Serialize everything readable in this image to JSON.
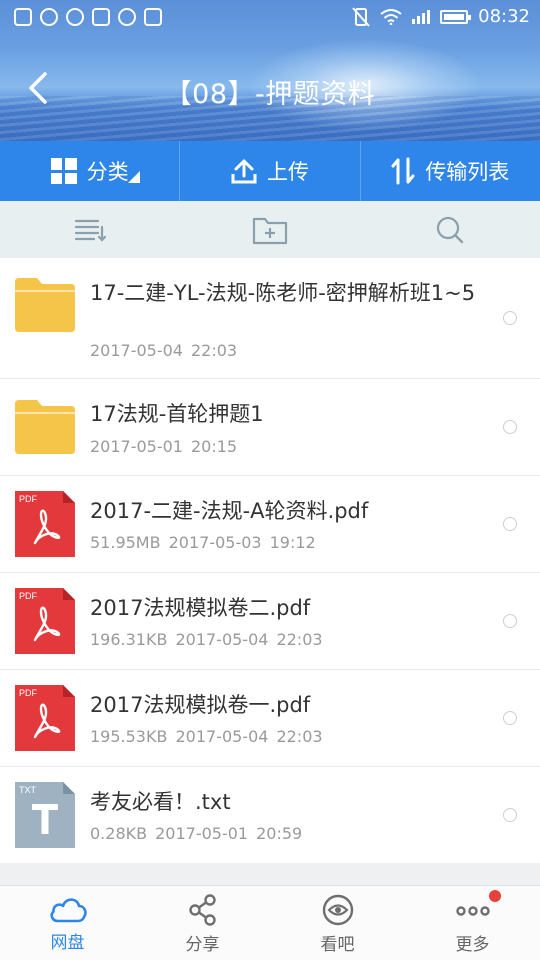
{
  "status_bar": {
    "time": "08:32",
    "left_icons": [
      "s-app-icon",
      "sync-app-icon",
      "chat-app-icon",
      "gallery-icon",
      "circle-app-icon",
      "grid-app-icon"
    ],
    "right_icons": [
      "vibrate-off-icon",
      "wifi-icon",
      "signal-icon",
      "battery-icon"
    ]
  },
  "header": {
    "title": "【08】-押题资料",
    "back_icon": "chevron-left-icon"
  },
  "action_bar": {
    "category_label": "分类",
    "upload_label": "上传",
    "transfer_label": "传输列表"
  },
  "toolbar": {
    "icons": [
      "sort-list-icon",
      "new-folder-icon",
      "search-icon"
    ]
  },
  "files": [
    {
      "name": "17-二建-YL-法规-陈老师-密押解析班1~5",
      "size": "",
      "date": "2017-05-04",
      "time": "22:03",
      "type": "folder"
    },
    {
      "name": "17法规-首轮押题1",
      "size": "",
      "date": "2017-05-01",
      "time": "20:15",
      "type": "folder"
    },
    {
      "name": "2017-二建-法规-A轮资料.pdf",
      "size": "51.95MB",
      "date": "2017-05-03",
      "time": "19:12",
      "type": "pdf"
    },
    {
      "name": "2017法规模拟卷二.pdf",
      "size": "196.31KB",
      "date": "2017-05-04",
      "time": "22:03",
      "type": "pdf"
    },
    {
      "name": "2017法规模拟卷一.pdf",
      "size": "195.53KB",
      "date": "2017-05-04",
      "time": "22:03",
      "type": "pdf"
    },
    {
      "name": "考友必看！.txt",
      "size": "0.28KB",
      "date": "2017-05-01",
      "time": "20:59",
      "type": "txt"
    }
  ],
  "file_badges": {
    "pdf": "PDF",
    "txt": "TXT"
  },
  "bottom_nav": [
    {
      "label": "网盘",
      "icon": "cloud-icon",
      "active": true
    },
    {
      "label": "分享",
      "icon": "share-icon",
      "active": false
    },
    {
      "label": "看吧",
      "icon": "eye-icon",
      "active": false
    },
    {
      "label": "更多",
      "icon": "more-icon",
      "active": false,
      "badge_dot": true
    }
  ],
  "colors": {
    "primary": "#2f86ea",
    "folder": "#f5c549",
    "pdf": "#e4393c",
    "txt": "#9eb2c2",
    "badge": "#e8413b"
  }
}
